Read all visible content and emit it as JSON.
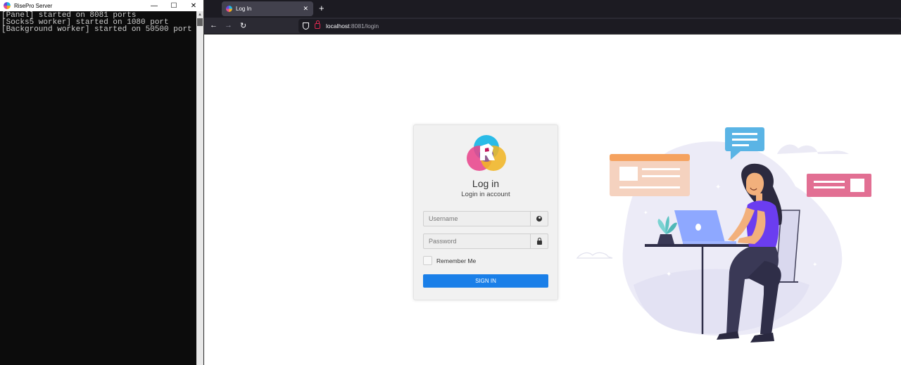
{
  "console": {
    "title": "RisePro Server",
    "controls": {
      "minimize": "—",
      "maximize": "☐",
      "close": "✕"
    },
    "lines": [
      "[Panel] started on 8081 ports",
      "[Socks5 worker] started on 1080 port",
      "[Background worker] started on 50500 port"
    ]
  },
  "browser": {
    "tab": {
      "title": "Log In",
      "close": "✕"
    },
    "new_tab": "+",
    "nav": {
      "back": "←",
      "forward": "→",
      "reload": "↻"
    },
    "url": {
      "host": "localhost",
      "path": ":8081/login"
    }
  },
  "login": {
    "title": "Log in",
    "subtitle": "Login in account",
    "username_placeholder": "Username",
    "password_placeholder": "Password",
    "remember_label": "Remember Me",
    "signin_label": "SIGN IN"
  },
  "colors": {
    "primary": "#1a7fe8",
    "tab_bg": "#42414d",
    "tabbar_bg": "#1c1b22",
    "toolbar_bg": "#2b2a33",
    "lock": "#e22850"
  }
}
